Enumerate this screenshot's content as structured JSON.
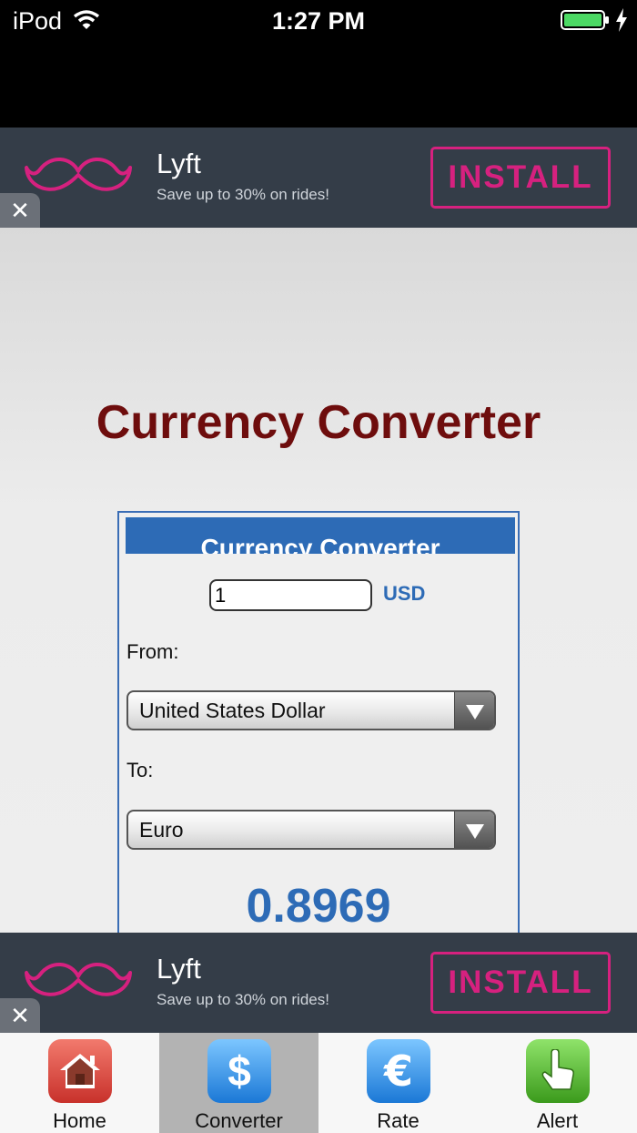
{
  "status_bar": {
    "device": "iPod",
    "time": "1:27 PM"
  },
  "ad": {
    "brand": "Lyft",
    "tagline": "Save up to 30% on rides!",
    "cta": "INSTALL",
    "close": "✕",
    "accent_color": "#d6217f"
  },
  "main": {
    "title": "Currency Converter",
    "widget": {
      "header": "Currency Converter",
      "amount_value": "1",
      "amount_unit": "USD",
      "from_label": "From:",
      "from_value": "United States Dollar",
      "to_label": "To:",
      "to_value": "Euro",
      "result": "0.8969"
    }
  },
  "tab_bar": {
    "tabs": [
      {
        "label": "Home",
        "icon": "home-icon",
        "active": false
      },
      {
        "label": "Converter",
        "icon": "dollar-icon",
        "active": true
      },
      {
        "label": "Rate",
        "icon": "euro-icon",
        "active": false
      },
      {
        "label": "Alert",
        "icon": "pointer-hand-icon",
        "active": false
      }
    ]
  }
}
